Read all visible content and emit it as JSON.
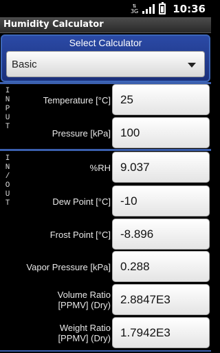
{
  "status_bar": {
    "network_label": "3G",
    "time": "10:36",
    "icons": [
      "3g-data-icon",
      "signal-icon",
      "battery-icon"
    ]
  },
  "app": {
    "title": "Humidity Calculator"
  },
  "selector": {
    "label": "Select Calculator",
    "value": "Basic"
  },
  "input_section": {
    "side_label": [
      "I",
      "N",
      "P",
      "U",
      "T"
    ],
    "rows": [
      {
        "label": "Temperature [°C]",
        "value": "25"
      },
      {
        "label": "Pressure [kPa]",
        "value": "100"
      }
    ]
  },
  "inout_section": {
    "side_label": [
      "I",
      "N",
      "/",
      "O",
      "U",
      "T"
    ],
    "rows": [
      {
        "label": "%RH",
        "value": "9.037"
      },
      {
        "label": "Dew Point [°C]",
        "value": "-10"
      },
      {
        "label": "Frost Point [°C]",
        "value": "-8.896"
      },
      {
        "label": "Vapor Pressure [kPa]",
        "value": "0.288"
      },
      {
        "label_line1": "Volume Ratio",
        "label_line2": "[PPMV] (Dry)",
        "value": "2.8847E3"
      },
      {
        "label_line1": "Weight Ratio",
        "label_line2": "[PPMV] (Dry)",
        "value": "1.7942E3"
      }
    ]
  },
  "colors": {
    "accent_blue": "#2b4aa6",
    "divider_blue": "#3b5fae",
    "background": "#000000"
  }
}
